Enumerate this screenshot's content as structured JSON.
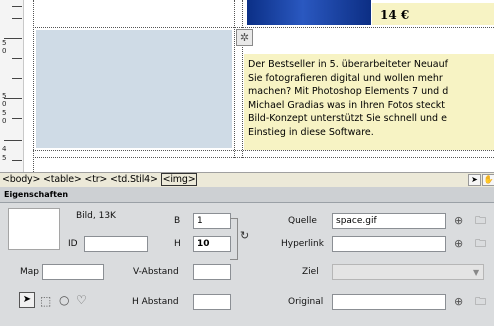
{
  "canvas": {
    "price": "14 €",
    "text_lines": [
      "Der Bestseller in 5. überarbeiteter Neuauf",
      "Sie fotografieren digital und wollen mehr",
      "machen? Mit Photoshop Elements 7 und d",
      "Michael Gradias was in Ihren Fotos steckt",
      "Bild-Konzept unterstützt Sie schnell und e",
      "Einstieg in diese Software."
    ],
    "ruler_numbers": [
      "5",
      "0",
      "5",
      "0",
      "5",
      "0",
      "4",
      "5"
    ]
  },
  "tag_selector": {
    "path": "<body> <table> <tr> <td.Stil4> ",
    "selected_tag": "<img>"
  },
  "inspector": {
    "tab_label": "Eigenschaften",
    "summary": "Bild, 13K",
    "id_label": "ID",
    "id_value": "",
    "width_label": "B",
    "width_value": "1",
    "height_label": "H",
    "height_value": "10",
    "source_label": "Quelle",
    "source_value": "space.gif",
    "link_label": "Hyperlink",
    "link_value": "",
    "map_label": "Map",
    "map_value": "",
    "vspace_label": "V-Abstand",
    "vspace_value": "",
    "hspace_label": "H Abstand",
    "hspace_value": "",
    "target_label": "Ziel",
    "target_value": "",
    "original_label": "Original",
    "original_value": ""
  },
  "icons": [
    "image-placeholder-icon",
    "point-to-file-icon",
    "browse-folder-icon",
    "refresh-size-icon",
    "pointer-hotspot-icon",
    "rectangle-hotspot-icon",
    "circle-hotspot-icon",
    "polygon-hotspot-icon",
    "select-tool-icon",
    "hand-tool-icon",
    "dropdown-arrow-icon"
  ],
  "colors": {
    "canvas_cell_blue": "#cfdbe6",
    "text_background_yellow": "#f7f3c4",
    "inspector_gray": "#dadcde",
    "tagbar_gray": "#ece9d8"
  }
}
